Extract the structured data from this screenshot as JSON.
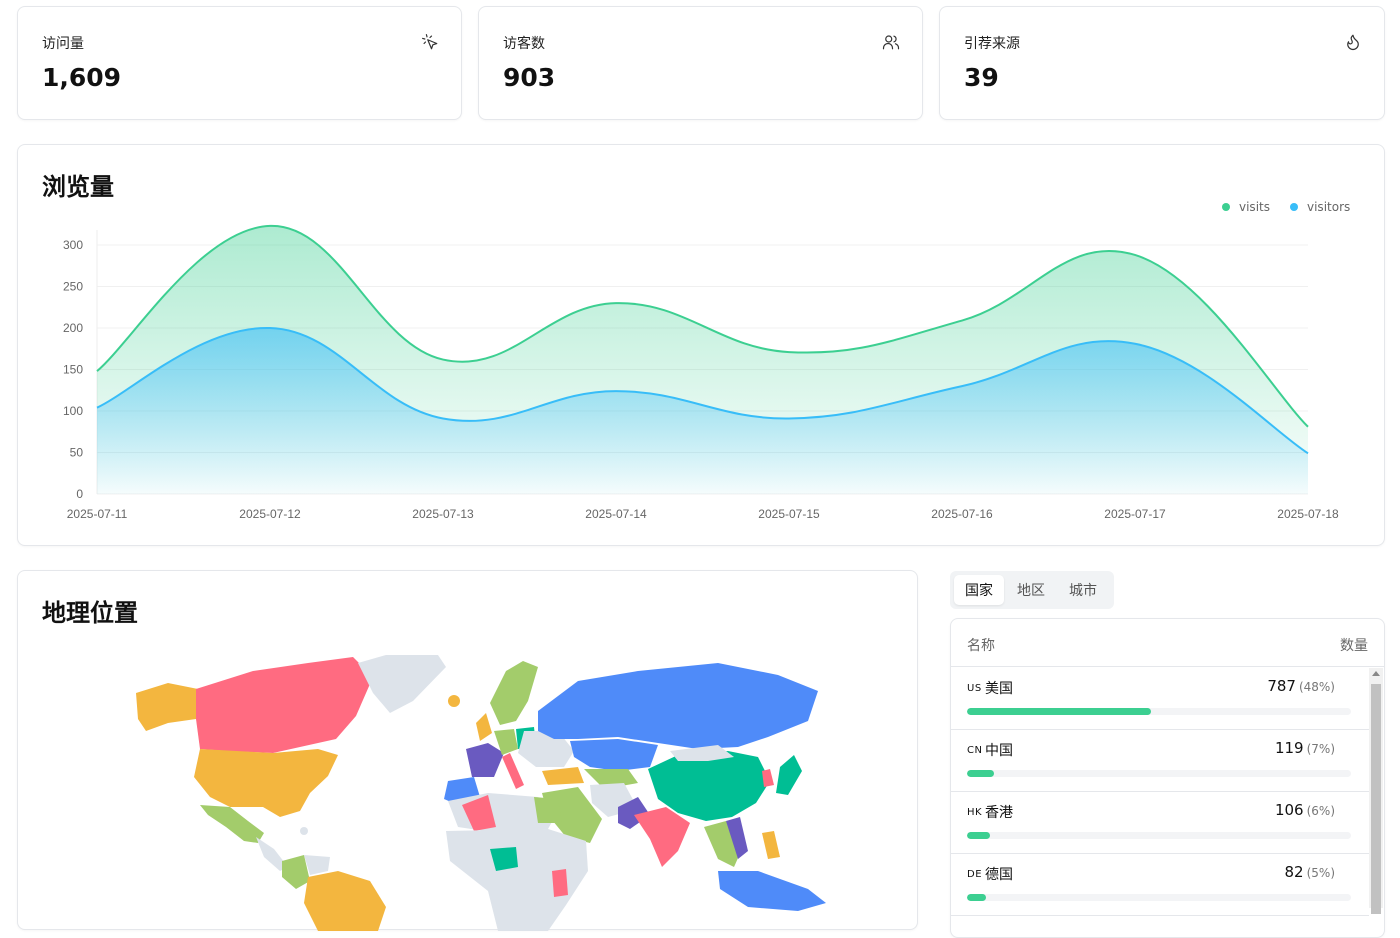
{
  "stats": [
    {
      "title": "访问量",
      "value": "1,609",
      "icon": "cursor-click-icon"
    },
    {
      "title": "访客数",
      "value": "903",
      "icon": "users-icon"
    },
    {
      "title": "引荐来源",
      "value": "39",
      "icon": "flame-icon"
    }
  ],
  "views_card": {
    "title": "浏览量"
  },
  "chart_data": {
    "type": "area",
    "categories": [
      "2025-07-11",
      "2025-07-12",
      "2025-07-13",
      "2025-07-14",
      "2025-07-15",
      "2025-07-16",
      "2025-07-17",
      "2025-07-18"
    ],
    "series": [
      {
        "name": "visits",
        "color": "#3ccf91",
        "values": [
          148,
          323,
          162,
          230,
          171,
          209,
          288,
          81
        ]
      },
      {
        "name": "visitors",
        "color": "#38bdf8",
        "values": [
          104,
          200,
          91,
          124,
          91,
          130,
          181,
          49
        ]
      }
    ],
    "yticks": [
      "0",
      "50",
      "100",
      "150",
      "200",
      "250",
      "300"
    ],
    "ylim": [
      0,
      320
    ],
    "grid": true,
    "legend_position": "top-right"
  },
  "geo_card": {
    "title": "地理位置"
  },
  "tabs": [
    {
      "label": "国家",
      "active": true
    },
    {
      "label": "地区",
      "active": false
    },
    {
      "label": "城市",
      "active": false
    }
  ],
  "table": {
    "name_header": "名称",
    "count_header": "数量",
    "rows": [
      {
        "code": "US",
        "name": "美国",
        "count": "787",
        "pct": "(48%)",
        "share": 0.48
      },
      {
        "code": "CN",
        "name": "中国",
        "count": "119",
        "pct": "(7%)",
        "share": 0.07
      },
      {
        "code": "HK",
        "name": "香港",
        "count": "106",
        "pct": "(6%)",
        "share": 0.06
      },
      {
        "code": "DE",
        "name": "德国",
        "count": "82",
        "pct": "(5%)",
        "share": 0.05
      }
    ]
  }
}
